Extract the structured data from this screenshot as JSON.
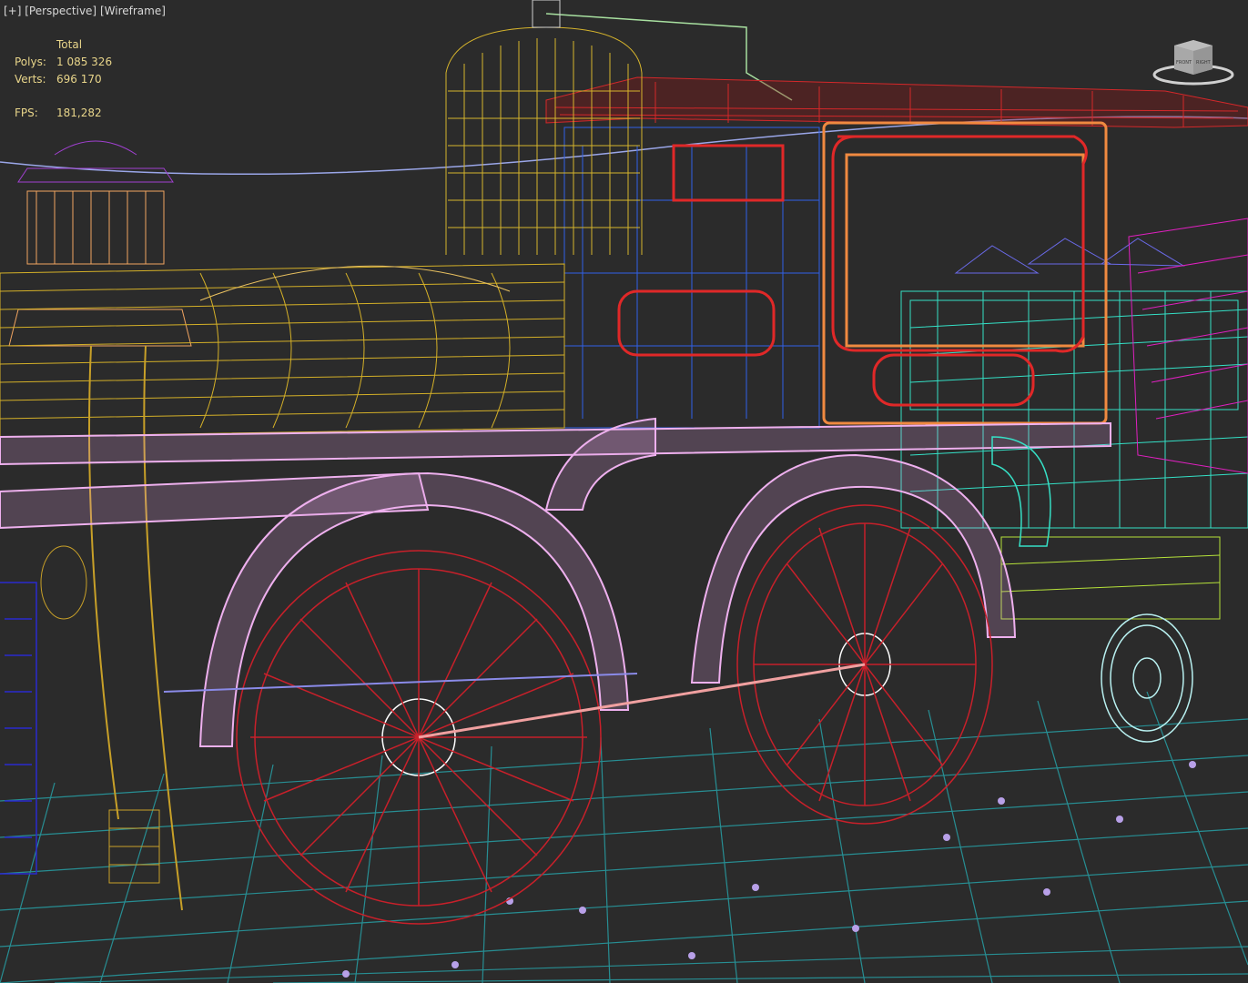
{
  "viewport": {
    "label_plus": "[+]",
    "label_view": "[Perspective]",
    "label_shading": "[Wireframe]"
  },
  "stats": {
    "header": "Total",
    "polys_label": "Polys:",
    "polys_value": "1 085 326",
    "verts_label": "Verts:",
    "verts_value": "696 170",
    "fps_label": "FPS:",
    "fps_value": "181,282"
  },
  "viewcube": {
    "front_label": "FRONT",
    "right_label": "RIGHT"
  },
  "colors": {
    "background": "#2b2b2b",
    "stats_text": "#e8d58a",
    "frame_pink": "#e8a6e8",
    "wheels_red": "#c0202a",
    "boiler_yellow": "#d4b028",
    "cab_red": "#d02a2a",
    "tender_cyan": "#30e0c8",
    "track_teal": "#2aa0a8"
  }
}
